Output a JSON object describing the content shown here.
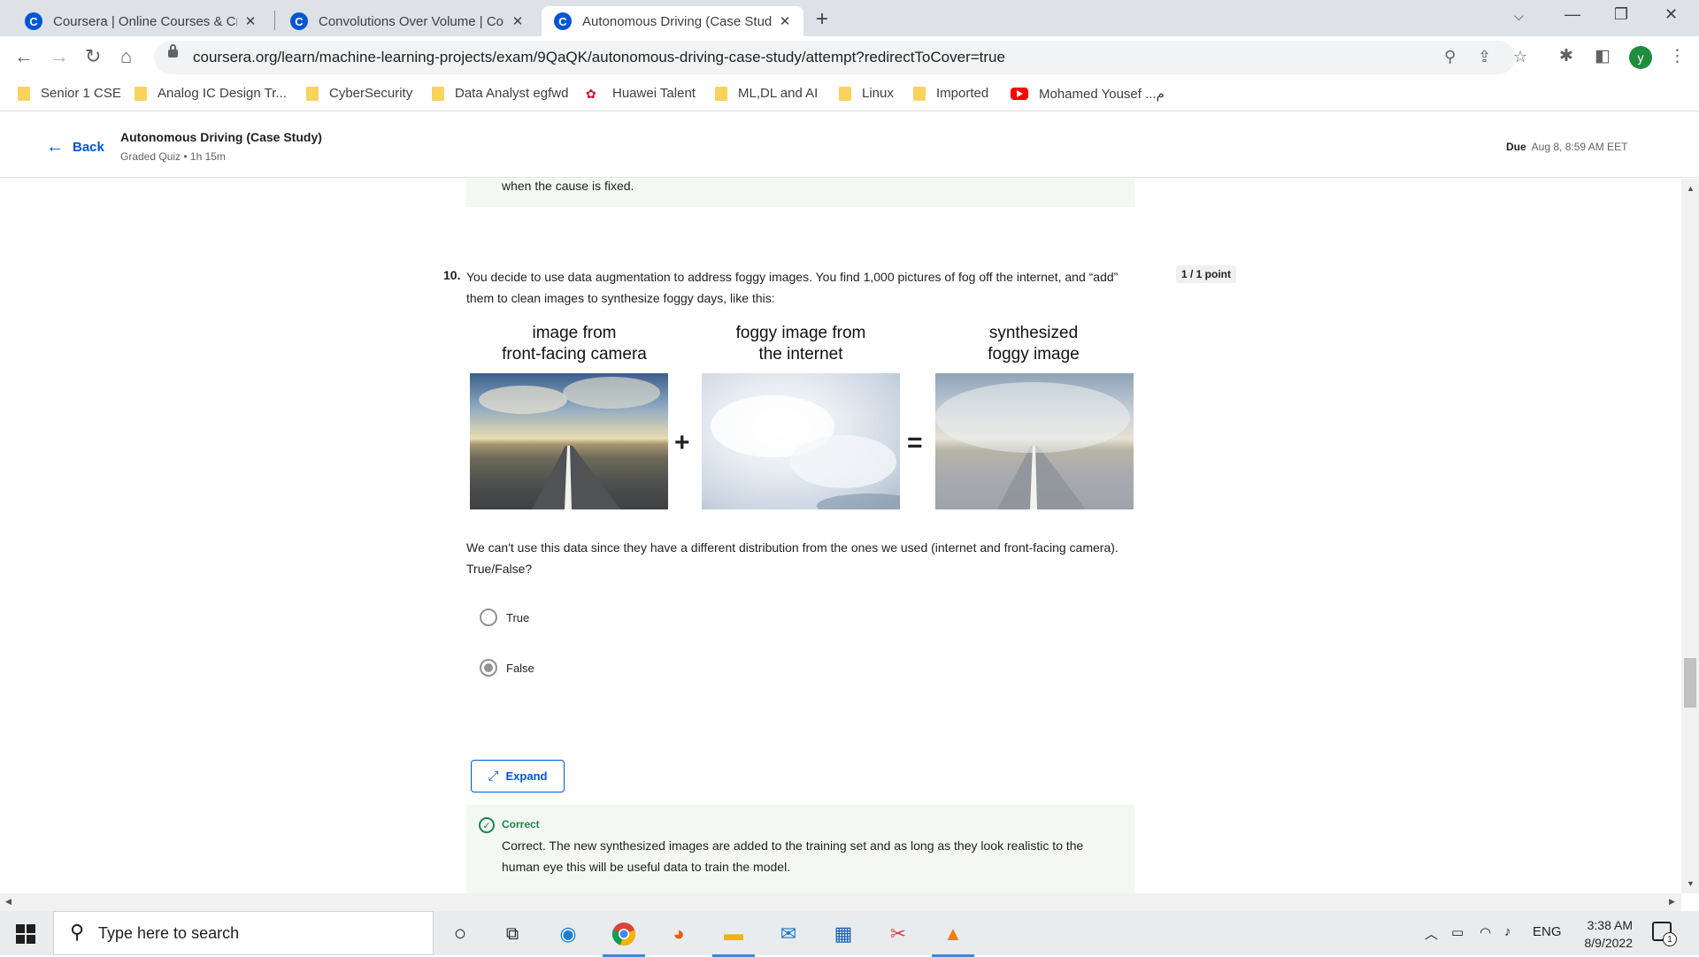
{
  "browser": {
    "tabs": [
      {
        "title": "Coursera | Online Courses & Crec",
        "favicon": "coursera-icon"
      },
      {
        "title": "Convolutions Over Volume | Cou",
        "favicon": "coursera-icon"
      },
      {
        "title": "Autonomous Driving (Case Study",
        "favicon": "coursera-icon",
        "active": true
      }
    ],
    "url": "coursera.org/learn/machine-learning-projects/exam/9QaQK/autonomous-driving-case-study/attempt?redirectToCover=true",
    "profile_initial": "y",
    "bookmarks": [
      {
        "label": "Senior 1 CSE",
        "icon": "folder-icon"
      },
      {
        "label": "Analog IC Design Tr...",
        "icon": "folder-icon"
      },
      {
        "label": "CyberSecurity",
        "icon": "folder-icon"
      },
      {
        "label": "Data Analyst egfwd",
        "icon": "folder-icon"
      },
      {
        "label": "Huawei Talent",
        "icon": "huawei-icon"
      },
      {
        "label": "ML,DL and AI",
        "icon": "folder-icon"
      },
      {
        "label": "Linux",
        "icon": "folder-icon"
      },
      {
        "label": "Imported",
        "icon": "folder-icon"
      },
      {
        "label": "Mohamed Yousef ...م",
        "icon": "youtube-icon"
      }
    ]
  },
  "header": {
    "back_label": "Back",
    "quiz_title": "Autonomous Driving (Case Study)",
    "quiz_subtitle": "Graded Quiz • 1h 15m",
    "due_label": "Due",
    "due_date": "Aug 8, 8:59 AM EET"
  },
  "prev_feedback_tail": "when the cause is fixed.",
  "question": {
    "number": "10.",
    "text": "You decide to use data augmentation to address foggy images. You find 1,000 pictures of fog off the internet, and “add” them to clean images to synthesize foggy days, like this:",
    "points": "1 / 1 point",
    "figure": {
      "captions": [
        "image from\nfront-facing camera",
        "foggy image from\nthe internet",
        "synthesized\nfoggy image"
      ],
      "caption_lines": [
        [
          "image from",
          "front-facing camera"
        ],
        [
          "foggy image from",
          "the internet"
        ],
        [
          "synthesized",
          "foggy image"
        ]
      ],
      "plus": "+",
      "equals": "="
    },
    "statement": "We can't use this data since they have a different distribution from the ones we used (internet and front-facing camera). True/False?",
    "options": [
      {
        "label": "True",
        "selected": false
      },
      {
        "label": "False",
        "selected": true
      }
    ],
    "expand_label": "Expand",
    "feedback": {
      "title": "Correct",
      "text": "Correct. The new synthesized images are added to the training set and as long as they look realistic to the human eye this will be useful data to train the model."
    }
  },
  "taskbar": {
    "search_placeholder": "Type here to search",
    "language": "ENG",
    "time": "3:38 AM",
    "date": "8/9/2022",
    "notification_count": "1"
  },
  "colors": {
    "accent": "#0056d2",
    "correct": "#1f8354",
    "feedback_bg": "#f3f8f3"
  }
}
